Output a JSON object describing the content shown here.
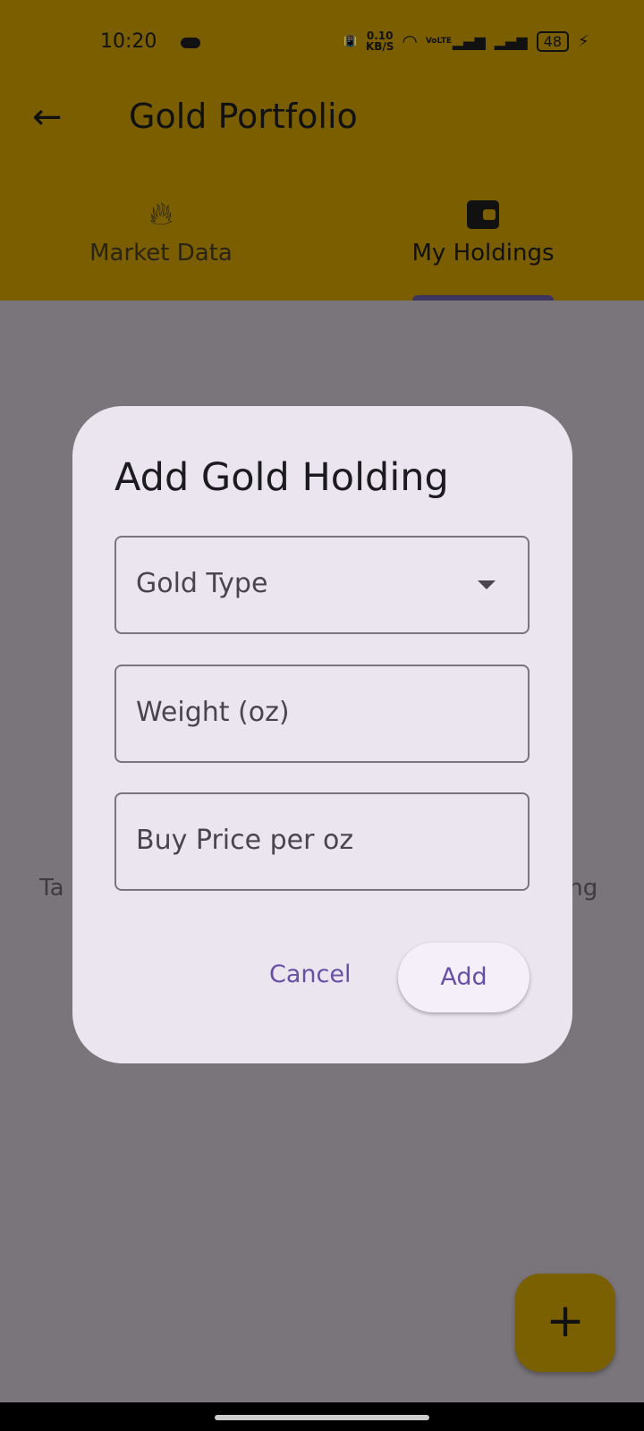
{
  "status_bar": {
    "time": "10:20",
    "net_speed": "0.10",
    "net_unit": "KB/S",
    "volte": "VoLTE",
    "battery": "48"
  },
  "app_bar": {
    "title": "Gold Portfolio"
  },
  "tabs": [
    {
      "label": "Market Data",
      "icon": "fire-icon",
      "selected": false
    },
    {
      "label": "My Holdings",
      "icon": "wallet-icon",
      "selected": true
    }
  ],
  "background": {
    "left_fragment": "Ta",
    "right_fragment": "ing"
  },
  "dialog": {
    "title": "Add Gold Holding",
    "fields": [
      {
        "label": "Gold Type",
        "type": "dropdown"
      },
      {
        "label": "Weight (oz)"
      },
      {
        "label": "Buy Price per oz"
      }
    ],
    "cancel": "Cancel",
    "add": "Add"
  },
  "fab": {
    "icon": "plus-icon",
    "label": "+"
  },
  "colors": {
    "header": "#7a5e00",
    "accent": "#6750a4",
    "dialog": "#ebe5f0"
  }
}
